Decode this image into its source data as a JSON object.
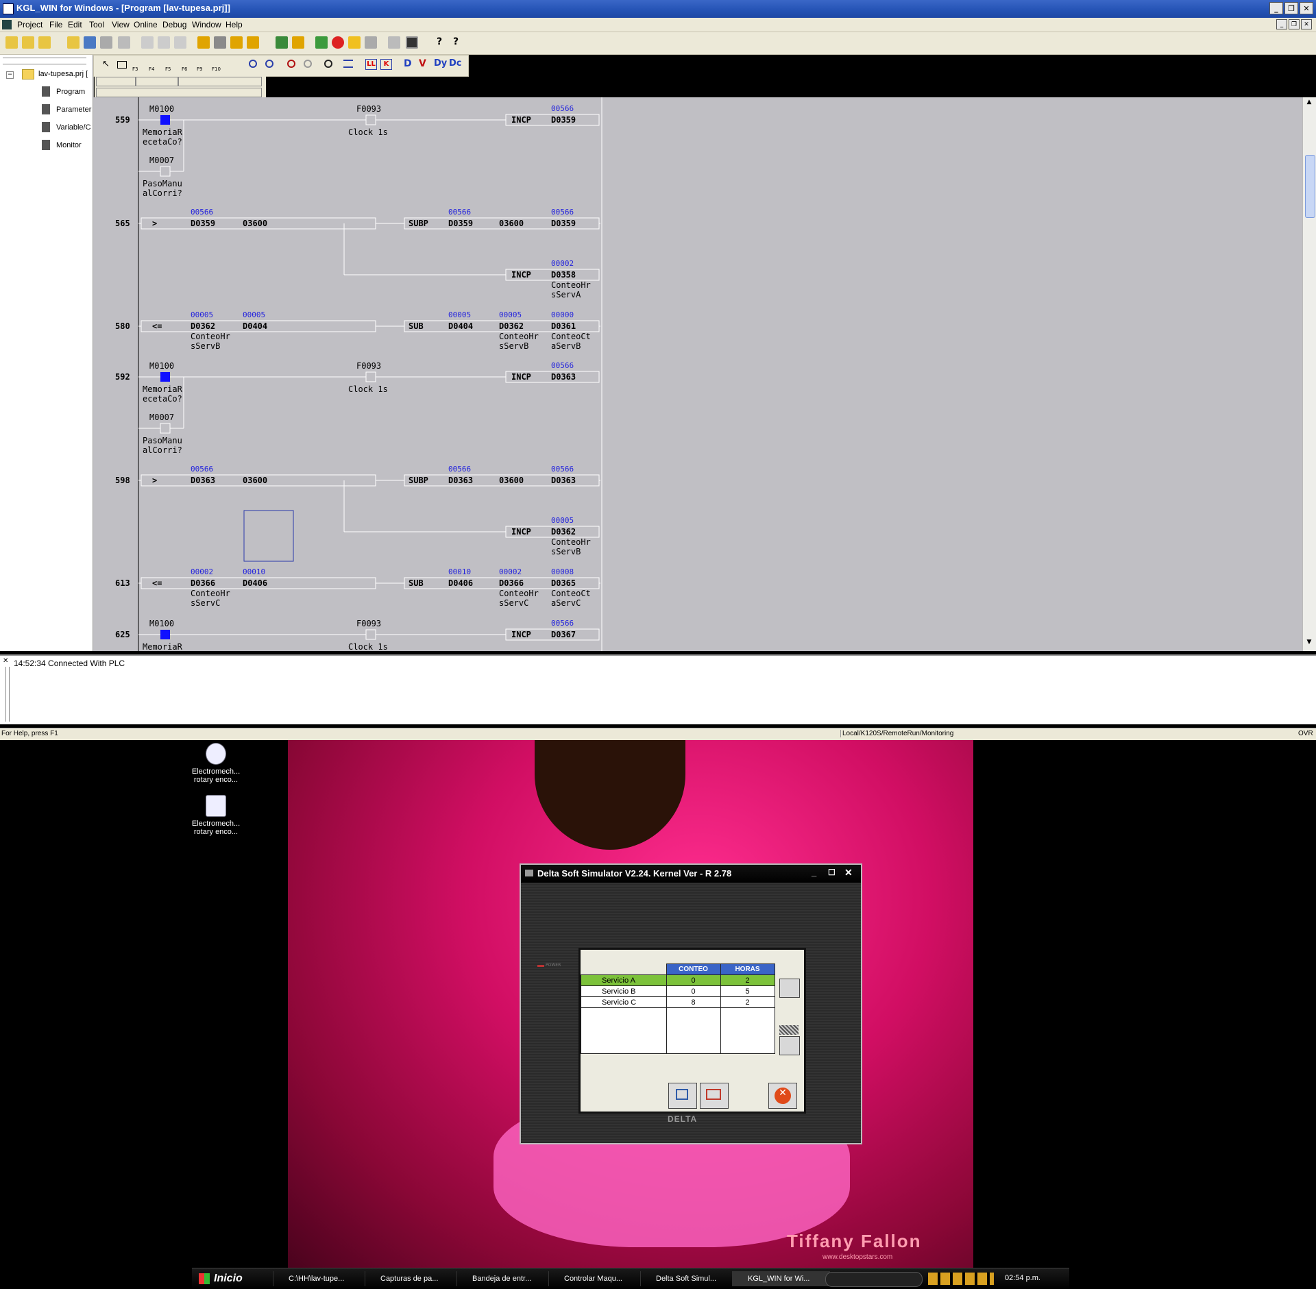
{
  "window": {
    "title": "KGL_WIN for Windows - [Program [lav-tupesa.prj]]",
    "menu": [
      "Project",
      "File",
      "Edit",
      "Tool",
      "View",
      "Online",
      "Debug",
      "Window",
      "Help"
    ]
  },
  "toolbar2_keys": [
    "F3",
    "F4",
    "F5",
    "F6",
    "F9",
    "F10"
  ],
  "toolbar2_letters": [
    "D",
    "V",
    "Dy",
    "Dc"
  ],
  "project_tree": {
    "root": "lav-tupesa.prj [",
    "items": [
      "Program",
      "Parameter",
      "Variable/C",
      "Monitor"
    ]
  },
  "ladder": {
    "line_numbers": [
      "559",
      "565",
      "580",
      "592",
      "598",
      "613",
      "625"
    ],
    "contacts": {
      "m0100": "M0100",
      "m0007": "M0007",
      "f0093": "F0093",
      "memoria_1": "MemoriaR",
      "memoria_2": "ecetaCo?",
      "paso_1": "PasoManu",
      "paso_2": "alCorri?",
      "clock": "Clock 1s"
    },
    "ops": {
      "incp": "INCP",
      "subp": "SUBP",
      "sub": "SUB",
      "gt": ">",
      "le": "<="
    },
    "regs": {
      "d0359": "D0359",
      "d0358": "D0358",
      "d0362": "D0362",
      "d0404": "D0404",
      "d0361": "D0361",
      "d0363": "D0363",
      "d0366": "D0366",
      "d0406": "D0406",
      "d0365": "D0365",
      "d0367": "D0367",
      "k3600": "03600"
    },
    "comments": {
      "hrsA_1": "ConteoHr",
      "hrsA_2": "sServA",
      "hrsB_1": "ConteoHr",
      "hrsB_2": "sServB",
      "ctB_1": "ConteoCt",
      "ctB_2": "aServB",
      "hrsC_1": "ConteoHr",
      "hrsC_2": "sServC",
      "ctC_1": "ConteoCt",
      "ctC_2": "aServC"
    },
    "monitor": {
      "v566": "00566",
      "v2": "00002",
      "v5": "00005",
      "v0": "00000",
      "v10": "00010",
      "v8": "00008"
    }
  },
  "output": {
    "message": "14:52:34 Connected With PLC"
  },
  "status": {
    "help": "For Help, press F1",
    "mode": "Local/K120S/RemoteRun/Monitoring",
    "ovr": "OVR"
  },
  "desktop_icons": [
    {
      "line1": "Electromech...",
      "line2": "rotary enco..."
    },
    {
      "line1": "Electromech...",
      "line2": "rotary enco..."
    }
  ],
  "wallpaper_text": {
    "name": "Tiffany Fallon",
    "site": "www.desktopstars.com"
  },
  "simulator": {
    "title": "Delta Soft Simulator V2.24. Kernel Ver - R 2.78",
    "power_label": "POWER",
    "logo": "DELTA",
    "headers": [
      "CONTEO",
      "HORAS"
    ],
    "rows": [
      {
        "name": "Servicio A",
        "conteo": "0",
        "horas": "2"
      },
      {
        "name": "Servicio B",
        "conteo": "0",
        "horas": "5"
      },
      {
        "name": "Servicio C",
        "conteo": "8",
        "horas": "2"
      }
    ]
  },
  "taskbar": {
    "start": "Inicio",
    "tasks": [
      "C:\\HH\\lav-tupe...",
      "Capturas de pa...",
      "Bandeja de entr...",
      "Controlar Maqu...",
      "Delta Soft Simul...",
      "KGL_WIN for Wi..."
    ],
    "clock": "02:54 p.m."
  }
}
